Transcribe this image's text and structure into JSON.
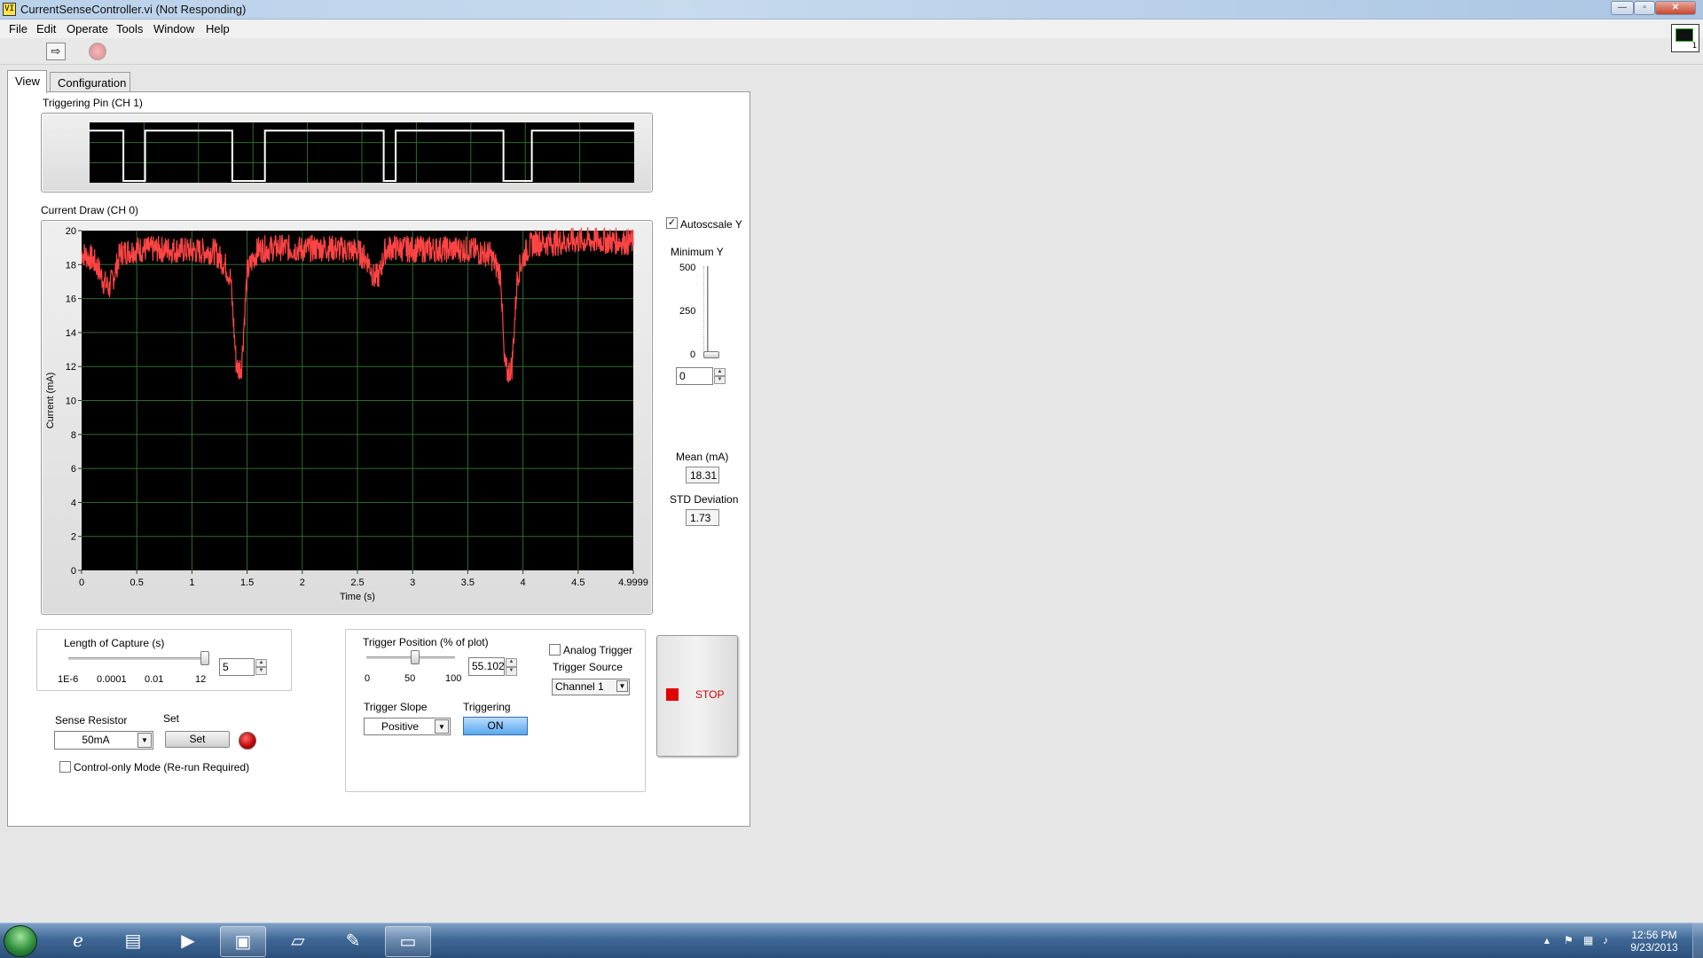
{
  "window": {
    "title": "CurrentSenseController.vi (Not Responding)",
    "icon_text": "VI"
  },
  "menu": [
    "File",
    "Edit",
    "Operate",
    "Tools",
    "Window",
    "Help"
  ],
  "toolbar": {
    "run_icon": "run-arrow-icon",
    "abort_icon": "abort-icon",
    "vi_icon_label": "1"
  },
  "tabs": [
    {
      "label": "View"
    },
    {
      "label": "Configuration"
    }
  ],
  "trigger_graph": {
    "title": "Triggering Pin (CH 1)"
  },
  "current_graph": {
    "title": "Current Draw (CH 0)",
    "ylabel": "Current (mA)",
    "xlabel": "Time (s)",
    "y_ticks": [
      "20",
      "18",
      "16",
      "14",
      "12",
      "10",
      "8",
      "6",
      "4",
      "2",
      "0"
    ],
    "x_ticks": [
      "0",
      "0.5",
      "1",
      "1.5",
      "2",
      "2.5",
      "3",
      "3.5",
      "4",
      "4.5",
      "4.9999"
    ]
  },
  "chart_data": [
    {
      "type": "line",
      "title": "Triggering Pin (CH 1)",
      "series": [
        {
          "values": [
            1,
            1,
            1,
            0,
            0,
            1,
            1,
            1,
            1,
            1,
            1,
            1,
            0,
            0,
            0,
            1,
            1,
            1,
            1,
            1,
            1,
            1,
            1,
            1,
            0,
            0,
            1,
            1,
            1,
            1,
            1,
            1,
            1,
            1,
            0,
            0,
            0,
            1,
            1,
            1,
            1,
            1,
            1,
            1,
            1
          ]
        }
      ],
      "x": [
        0,
        0.1,
        0.3,
        0.31,
        0.5,
        0.51,
        0.7,
        0.9,
        1.0,
        1.1,
        1.2,
        1.3,
        1.31,
        1.5,
        1.6,
        1.61,
        1.8,
        2.0,
        2.2,
        2.4,
        2.5,
        2.6,
        2.65,
        2.69,
        2.7,
        2.8,
        2.81,
        3.0,
        3.2,
        3.4,
        3.6,
        3.7,
        3.75,
        3.79,
        3.8,
        3.95,
        4.05,
        4.06,
        4.2,
        4.4,
        4.6,
        4.8,
        4.9,
        4.95,
        5.0
      ],
      "ylim": [
        0,
        1.2
      ],
      "xlim": [
        0,
        5
      ],
      "grid": true
    },
    {
      "type": "line",
      "title": "Current Draw (CH 0)",
      "xlabel": "Time (s)",
      "ylabel": "Current (mA)",
      "x": [
        0,
        0.1,
        0.15,
        0.2,
        0.25,
        0.3,
        0.35,
        0.5,
        0.8,
        1.0,
        1.2,
        1.3,
        1.35,
        1.4,
        1.42,
        1.45,
        1.5,
        1.55,
        1.6,
        1.8,
        2.0,
        2.2,
        2.5,
        2.6,
        2.65,
        2.7,
        2.75,
        2.8,
        3.0,
        3.2,
        3.5,
        3.7,
        3.8,
        3.83,
        3.86,
        3.9,
        3.95,
        4.0,
        4.05,
        4.1,
        4.3,
        4.5,
        4.8,
        4.9999
      ],
      "series": [
        {
          "values": [
            18.7,
            18.3,
            17.8,
            17.0,
            16.6,
            17.5,
            18.7,
            18.9,
            18.9,
            18.8,
            18.8,
            18.0,
            17.2,
            12.3,
            11.8,
            12.1,
            17.5,
            18.3,
            18.9,
            19.0,
            18.9,
            19.0,
            18.8,
            18.2,
            17.2,
            17.4,
            18.8,
            19.0,
            18.9,
            18.9,
            18.9,
            18.6,
            17.4,
            12.2,
            11.6,
            12.0,
            17.4,
            18.4,
            19.0,
            19.3,
            19.3,
            19.4,
            19.4,
            19.3
          ]
        }
      ],
      "xlim": [
        0,
        4.9999
      ],
      "ylim": [
        0,
        20
      ],
      "grid": true,
      "colors": {
        "trace": "#ff4444",
        "background": "#000000",
        "grid": "#2f6b2f"
      }
    }
  ],
  "autoscale": {
    "label": "Autoscsale Y",
    "checked": "✓"
  },
  "min_y": {
    "label": "Minimum Y",
    "ticks": [
      "500",
      "250",
      "0"
    ],
    "value": "0",
    "level": 0
  },
  "mean": {
    "label": "Mean (mA)",
    "value": "18.31"
  },
  "std": {
    "label": "STD Deviation",
    "value": "1.73"
  },
  "capture": {
    "label": "Length of Capture (s)",
    "ticks": [
      "1E-6",
      "0.0001",
      "0.01",
      "12"
    ],
    "value": "5"
  },
  "sense": {
    "label": "Sense Resistor",
    "value": "50mA"
  },
  "set": {
    "label": "Set",
    "button": "Set"
  },
  "control_only": {
    "label": "Control-only Mode (Re-run Required)"
  },
  "trigger_position": {
    "label": "Trigger Position (% of plot)",
    "ticks": [
      "0",
      "50",
      "100"
    ],
    "value": "55.102",
    "level_percent": 55.102
  },
  "analog_trigger": {
    "label": "Analog Trigger"
  },
  "trigger_source": {
    "label": "Trigger Source",
    "value": "Channel 1"
  },
  "trigger_slope": {
    "label": "Trigger Slope",
    "value": "Positive"
  },
  "triggering": {
    "label": "Triggering",
    "value": "ON"
  },
  "stop": {
    "label": "STOP"
  },
  "taskbar": {
    "clock_time": "12:56 PM",
    "clock_date": "9/23/2013",
    "icons": [
      "ie-icon",
      "explorer-icon",
      "media-player-icon",
      "labview-icon",
      "notepad-icon",
      "paint-icon",
      "remote-desktop-icon"
    ]
  }
}
